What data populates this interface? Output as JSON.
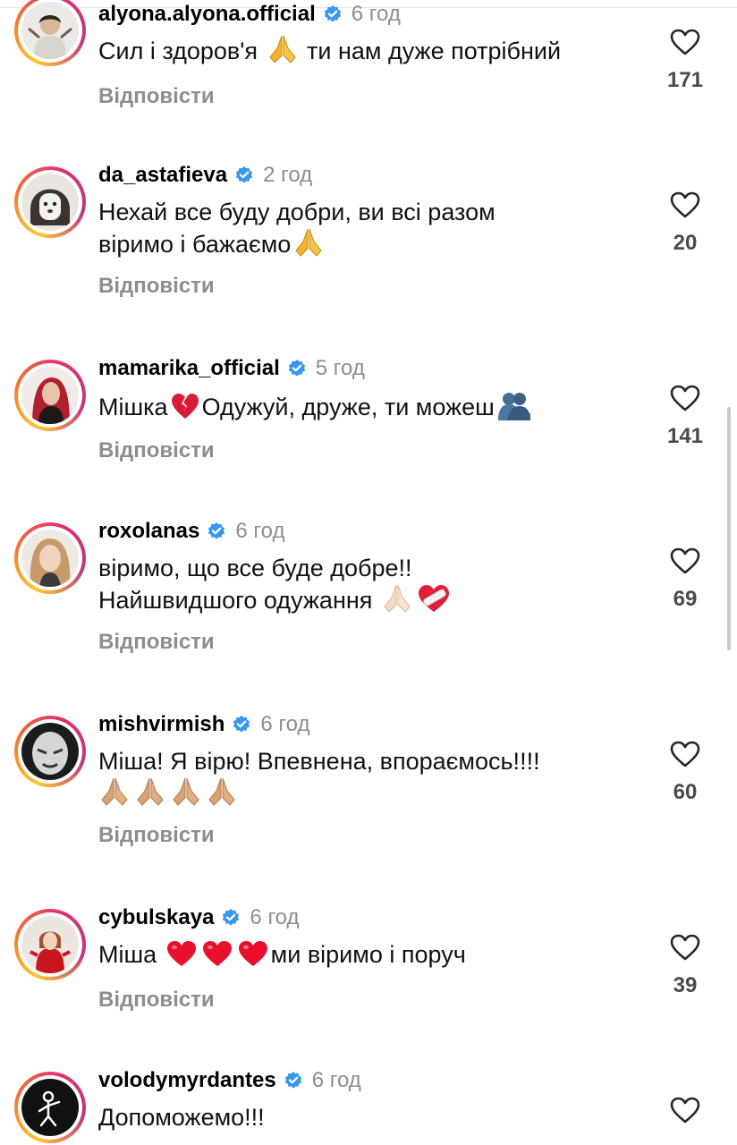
{
  "comments": [
    {
      "username": "alyona.alyona.official",
      "time": "6 год",
      "text_before": "Сил і здоров'я ",
      "emoji": "folded-hands-emoji",
      "text_after": " ти нам дуже потрібний",
      "reply_label": "Відповісти",
      "likes": "171"
    },
    {
      "username": "da_astafieva",
      "time": "2 год",
      "text_line1": "Нехай все буду добри, ви всі разом",
      "text_line2": "віримо і бажаємо",
      "emoji": "folded-hands-emoji",
      "reply_label": "Відповісти",
      "likes": "20"
    },
    {
      "username": "mamarika_official",
      "time": "5 год",
      "text_part1": "Мішка",
      "emoji1": "broken-heart-emoji",
      "text_part2": "Одужуй, друже, ти можеш",
      "emoji2": "people-hugging-emoji",
      "reply_label": "Відповісти",
      "likes": "141"
    },
    {
      "username": "roxolanas",
      "time": "6 год",
      "text_line1": "віримо, що все буде добре!!",
      "text_line2": "Найшвидшого одужання ",
      "emoji1": "folded-hands-light-emoji",
      "emoji2": "mending-heart-emoji",
      "reply_label": "Відповісти",
      "likes": "69"
    },
    {
      "username": "mishvirmish",
      "time": "6 год",
      "text_line1": "Міша! Я вірю! Впевнена, впораємось!!!!",
      "emoji": "folded-hands-medium-emoji",
      "emoji_count": 4,
      "reply_label": "Відповісти",
      "likes": "60"
    },
    {
      "username": "cybulskaya",
      "time": "6 год",
      "text_before": "Міша ",
      "emoji": "red-heart-emoji",
      "emoji_count": 3,
      "text_after": "ми віримо і поруч",
      "reply_label": "Відповісти",
      "likes": "39"
    },
    {
      "username": "volodymyrdantes",
      "time": "6 год",
      "text": "Допоможемо!!!"
    }
  ],
  "colors": {
    "verified": "#3897f0",
    "secondary_text": "#8e8e8e",
    "count_text": "#4a4a4a",
    "heart_red": "#e8102a"
  }
}
